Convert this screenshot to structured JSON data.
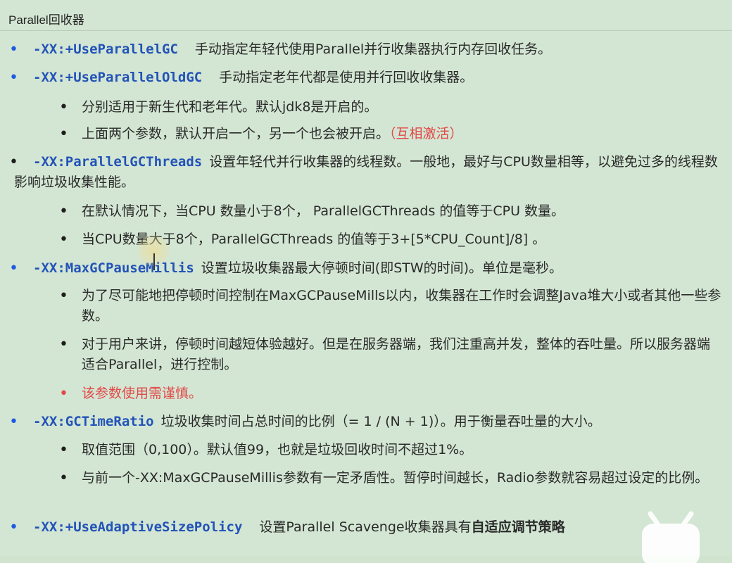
{
  "window": {
    "title": "Parallel回收器"
  },
  "items": {
    "i1": {
      "flag": "-XX:+UseParallelGC",
      "desc": "手动指定年轻代使用Parallel并行收集器执行内存回收任务。"
    },
    "i2": {
      "flag": "-XX:+UseParallelOldGC",
      "desc": "手动指定老年代都是使用并行回收收集器。",
      "sub1": "分别适用于新生代和老年代。默认jdk8是开启的。",
      "sub2": "上面两个参数，默认开启一个，另一个也会被开启。",
      "sub2_note": "（互相激活）"
    },
    "i3": {
      "flag": "-XX:ParallelGCThreads",
      "desc": "设置年轻代并行收集器的线程数。一般地，最好与CPU数量相等，以避免过多的线程数影响垃圾收集性能。",
      "sub1": "在默认情况下，当CPU 数量小于8个， ParallelGCThreads 的值等于CPU 数量。",
      "sub2": "当CPU数量大于8个，ParallelGCThreads 的值等于3+[5*CPU_Count]/8] 。"
    },
    "i4": {
      "flag": "-XX:MaxGCPauseMillis",
      "desc": "设置垃圾收集器最大停顿时间(即STW的时间)。单位是毫秒。",
      "sub1": "为了尽可能地把停顿时间控制在MaxGCPauseMills以内，收集器在工作时会调整Java堆大小或者其他一些参数。",
      "sub2": "对于用户来讲，停顿时间越短体验越好。但是在服务器端，我们注重高并发，整体的吞吐量。所以服务器端适合Parallel，进行控制。",
      "sub3": "该参数使用需谨慎。"
    },
    "i5": {
      "flag": "-XX:GCTimeRatio",
      "desc": "垃圾收集时间占总时间的比例（= 1 / (N + 1)）。用于衡量吞吐量的大小。",
      "sub1": "取值范围（0,100）。默认值99，也就是垃圾回收时间不超过1%。",
      "sub2": "与前一个-XX:MaxGCPauseMillis参数有一定矛盾性。暂停时间越长，Radio参数就容易超过设定的比例。"
    },
    "i6": {
      "flag": "-XX:+UseAdaptiveSizePolicy",
      "desc": "设置Parallel Scavenge收集器具有",
      "desc_bold": "自适应调节策略"
    }
  },
  "colors": {
    "background": "#d3e6d3",
    "flag": "#2253b8",
    "top_bullet": "#1e5ae0",
    "warning": "#e24848"
  },
  "icons": {
    "logo": "bilibili-tv-icon",
    "cursor": "text-cursor-icon"
  }
}
